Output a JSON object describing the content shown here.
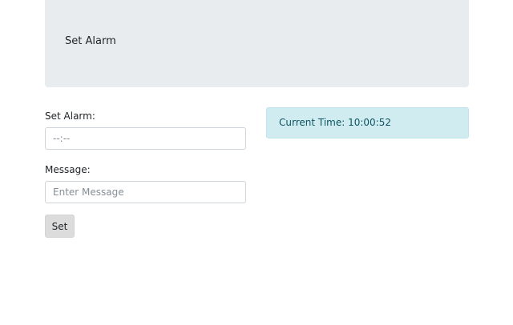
{
  "jumbotron": {
    "title": "Set Alarm"
  },
  "form": {
    "alarm_label": "Set Alarm:",
    "alarm_placeholder": "--:--",
    "message_label": "Message:",
    "message_placeholder": "Enter Message",
    "set_button_label": "Set"
  },
  "status": {
    "current_time_text": "Current Time: 10:00:52"
  },
  "colors": {
    "jumbotron_bg": "#e9ecef",
    "alert_bg": "#d1ecf1",
    "alert_text": "#0c5460",
    "button_bg": "#dcdcdc"
  }
}
